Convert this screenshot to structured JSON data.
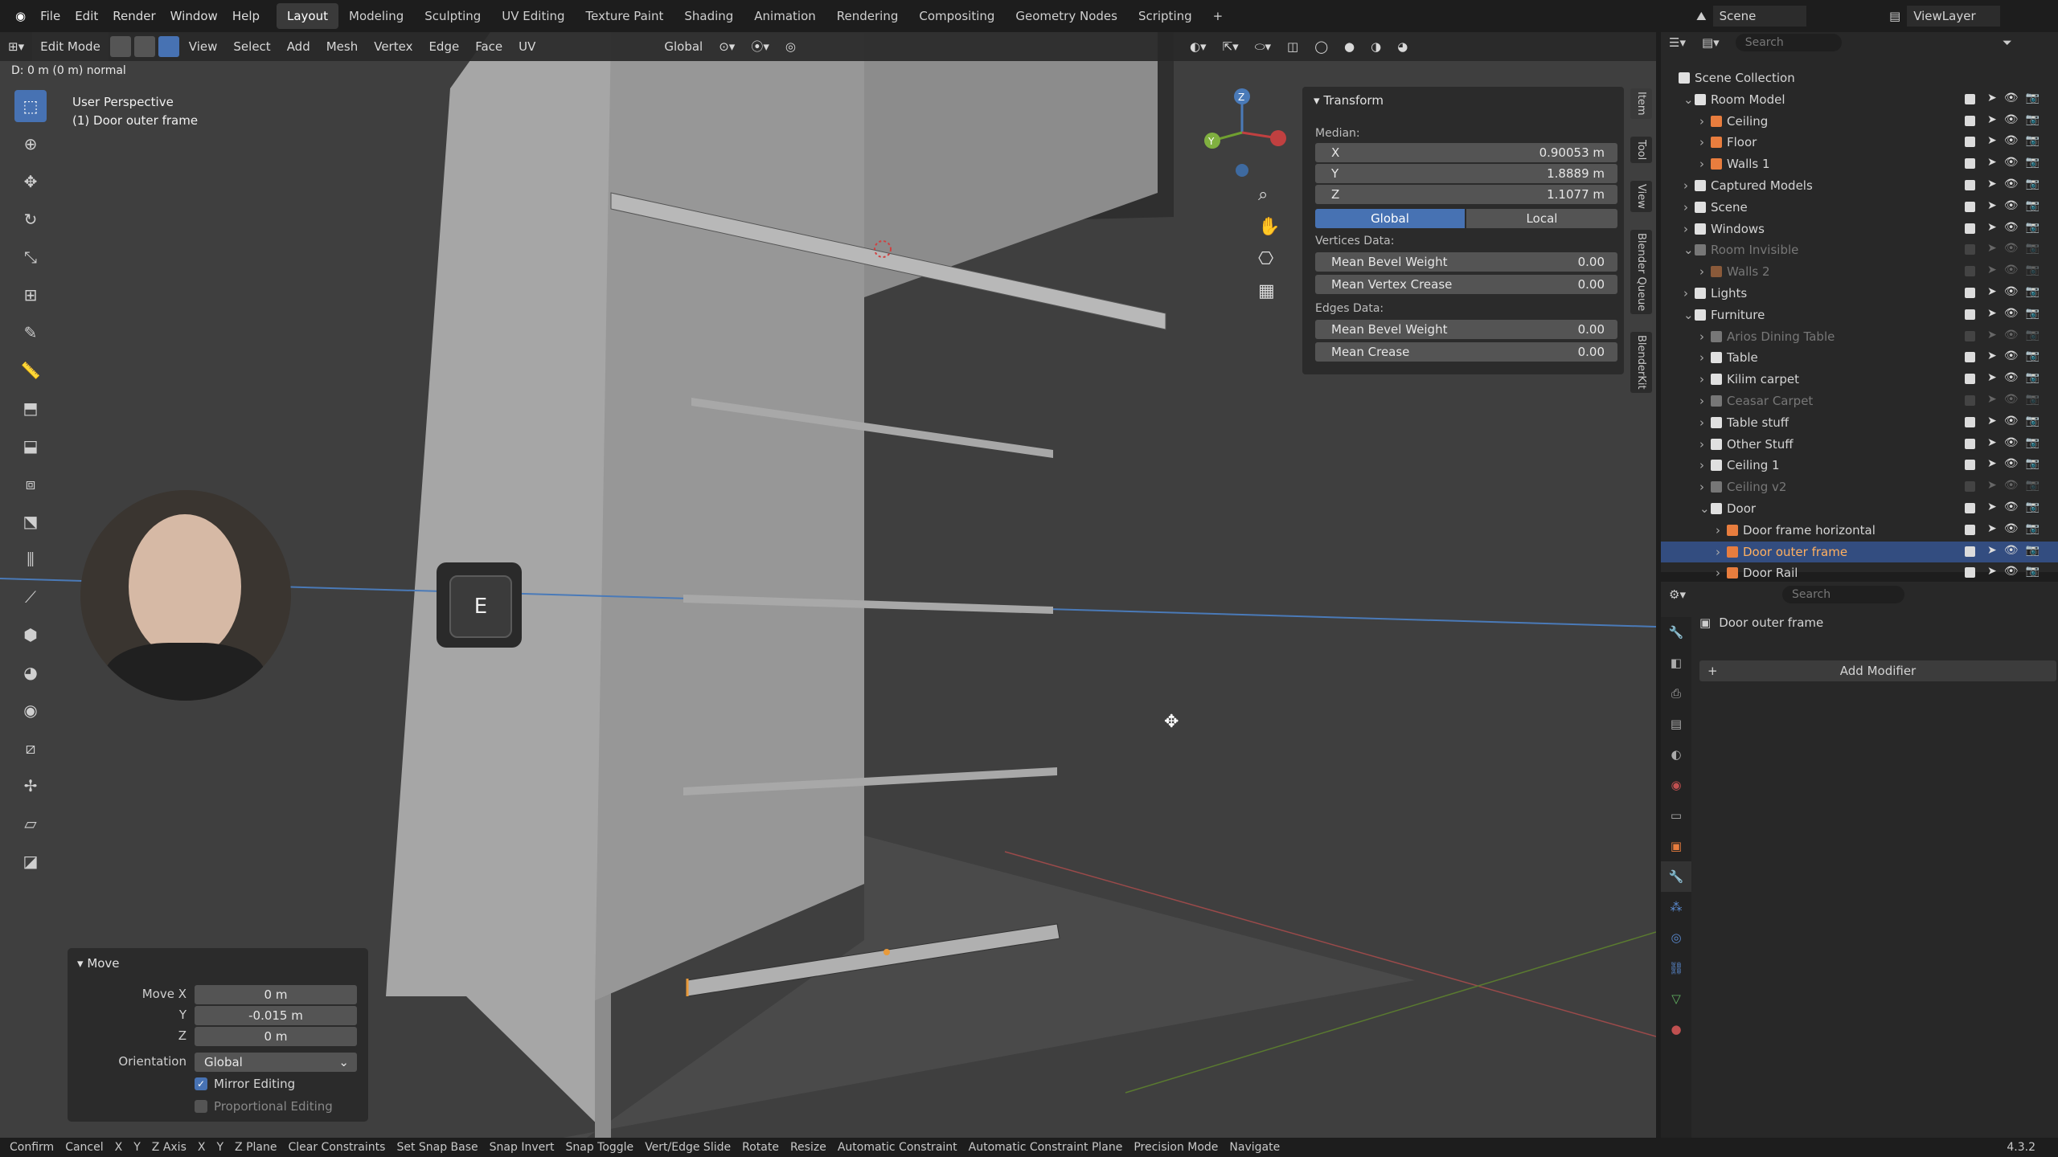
{
  "menubar": {
    "items": [
      "File",
      "Edit",
      "Render",
      "Window",
      "Help"
    ],
    "workspaces": [
      "Layout",
      "Modeling",
      "Sculpting",
      "UV Editing",
      "Texture Paint",
      "Shading",
      "Animation",
      "Rendering",
      "Compositing",
      "Geometry Nodes",
      "Scripting"
    ],
    "active_workspace": "Layout",
    "add_tab": "+",
    "scene": "Scene",
    "view_layer": "ViewLayer"
  },
  "viewport": {
    "mode": "Edit Mode",
    "menus": [
      "View",
      "Select",
      "Add",
      "Mesh",
      "Vertex",
      "Edge",
      "Face",
      "UV"
    ],
    "orientation": "Global",
    "status_line": "D: 0 m (0 m) normal",
    "perspective_label": "User Perspective",
    "object_label": "(1) Door outer frame",
    "key_overlay": "E",
    "gizmo_axes": [
      "X",
      "Y",
      "Z"
    ]
  },
  "npanel": {
    "section": "Transform",
    "median_label": "Median:",
    "median": [
      {
        "axis": "X",
        "value": "0.90053 m"
      },
      {
        "axis": "Y",
        "value": "1.8889 m"
      },
      {
        "axis": "Z",
        "value": "1.1077 m"
      }
    ],
    "global_label": "Global",
    "local_label": "Local",
    "vertices_label": "Vertices Data:",
    "vertices": [
      {
        "label": "Mean Bevel Weight",
        "value": "0.00"
      },
      {
        "label": "Mean Vertex Crease",
        "value": "0.00"
      }
    ],
    "edges_label": "Edges Data:",
    "edges": [
      {
        "label": "Mean Bevel Weight",
        "value": "0.00"
      },
      {
        "label": "Mean Crease",
        "value": "0.00"
      }
    ],
    "side_tabs": [
      "Item",
      "Tool",
      "View",
      "Blender Queue",
      "BlenderKit"
    ]
  },
  "outliner": {
    "search_placeholder": "Search",
    "rows": [
      {
        "name": "Scene Collection",
        "indent": 0,
        "type": "collection"
      },
      {
        "name": "Room Model",
        "indent": 1,
        "type": "collection"
      },
      {
        "name": "Ceiling",
        "indent": 2,
        "type": "mesh"
      },
      {
        "name": "Floor",
        "indent": 2,
        "type": "mesh"
      },
      {
        "name": "Walls 1",
        "indent": 2,
        "type": "mesh"
      },
      {
        "name": "Captured Models",
        "indent": 1,
        "type": "collection"
      },
      {
        "name": "Scene",
        "indent": 1,
        "type": "collection"
      },
      {
        "name": "Windows",
        "indent": 1,
        "type": "collection"
      },
      {
        "name": "Room Invisible",
        "indent": 1,
        "type": "collection-dim"
      },
      {
        "name": "Walls 2",
        "indent": 2,
        "type": "mesh-dim"
      },
      {
        "name": "Lights",
        "indent": 1,
        "type": "collection"
      },
      {
        "name": "Furniture",
        "indent": 1,
        "type": "collection"
      },
      {
        "name": "Arios Dining Table",
        "indent": 2,
        "type": "dim"
      },
      {
        "name": "Table",
        "indent": 2,
        "type": "collection"
      },
      {
        "name": "Kilim carpet",
        "indent": 2,
        "type": "collection"
      },
      {
        "name": "Ceasar Carpet",
        "indent": 2,
        "type": "dim"
      },
      {
        "name": "Table stuff",
        "indent": 2,
        "type": "collection"
      },
      {
        "name": "Other Stuff",
        "indent": 2,
        "type": "collection"
      },
      {
        "name": "Ceiling 1",
        "indent": 2,
        "type": "collection"
      },
      {
        "name": "Ceiling v2",
        "indent": 2,
        "type": "dim"
      },
      {
        "name": "Door",
        "indent": 2,
        "type": "collection"
      },
      {
        "name": "Door frame horizontal",
        "indent": 3,
        "type": "mesh"
      },
      {
        "name": "Door outer frame",
        "indent": 3,
        "type": "mesh-selected"
      },
      {
        "name": "Door Rail",
        "indent": 3,
        "type": "mesh"
      }
    ]
  },
  "properties": {
    "search_placeholder": "Search",
    "object_name": "Door outer frame",
    "add_modifier": "Add Modifier"
  },
  "operator": {
    "title": "Move",
    "move_x_label": "Move X",
    "move_x": "0 m",
    "y_label": "Y",
    "y": "-0.015 m",
    "z_label": "Z",
    "z": "0 m",
    "orientation_label": "Orientation",
    "orientation": "Global",
    "mirror_label": "Mirror Editing",
    "proportional_label": "Proportional Editing"
  },
  "statusbar": {
    "items": [
      "Confirm",
      "Cancel",
      "X",
      "Y",
      "Z Axis",
      "X",
      "Y",
      "Z Plane",
      "Clear Constraints",
      "Set Snap Base",
      "Snap Invert",
      "Snap Toggle",
      "Vert/Edge Slide",
      "Rotate",
      "Resize",
      "Automatic Constraint",
      "Automatic Constraint Plane",
      "Precision Mode",
      "Navigate"
    ],
    "version": "4.3.2"
  },
  "colors": {
    "accent": "#4772b3",
    "selected_row": "#334d80",
    "mesh_icon": "#e87d3e",
    "collection_icon": "#dcdcdc"
  }
}
